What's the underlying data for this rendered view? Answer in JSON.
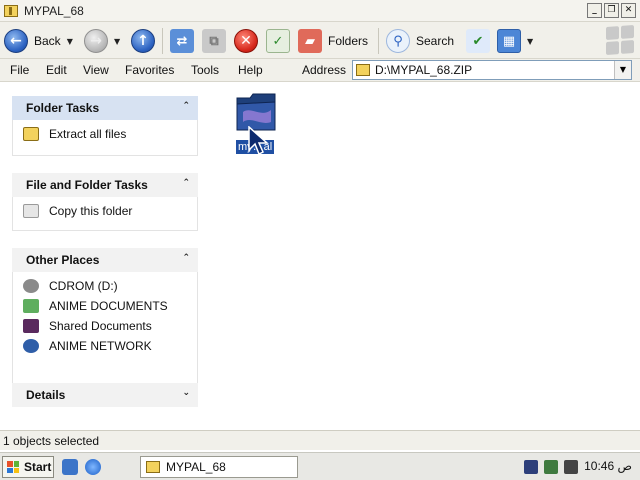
{
  "window": {
    "title": "MYPAL_68"
  },
  "toolbar": {
    "back": "Back",
    "folders": "Folders",
    "search": "Search"
  },
  "menu": {
    "items": [
      "File",
      "Edit",
      "View",
      "Favorites",
      "Tools",
      "Help"
    ]
  },
  "address": {
    "label": "Address",
    "value": "D:\\MYPAL_68.ZIP"
  },
  "panes": {
    "folder_tasks": {
      "title": "Folder Tasks",
      "items": [
        "Extract all files"
      ]
    },
    "file_folder_tasks": {
      "title": "File and Folder Tasks",
      "items": [
        "Copy this folder"
      ]
    },
    "other_places": {
      "title": "Other Places",
      "items": [
        "CDROM (D:)",
        "ANIME DOCUMENTS",
        "Shared Documents",
        "ANIME NETWORK"
      ]
    },
    "details": {
      "title": "Details"
    }
  },
  "content": {
    "item_label": "my…al"
  },
  "status": {
    "text": "1 objects selected"
  },
  "taskbar": {
    "start": "Start",
    "window_button": "MYPAL_68",
    "clock": "10:46 ص"
  },
  "colors": {
    "selection": "#1f4fa3",
    "pane_header": "#d7e2f2"
  },
  "icons": [
    "folder-zip-icon",
    "back-icon",
    "forward-icon",
    "up-icon",
    "search-icon",
    "folders-icon",
    "views-icon",
    "windows-logo-icon"
  ]
}
